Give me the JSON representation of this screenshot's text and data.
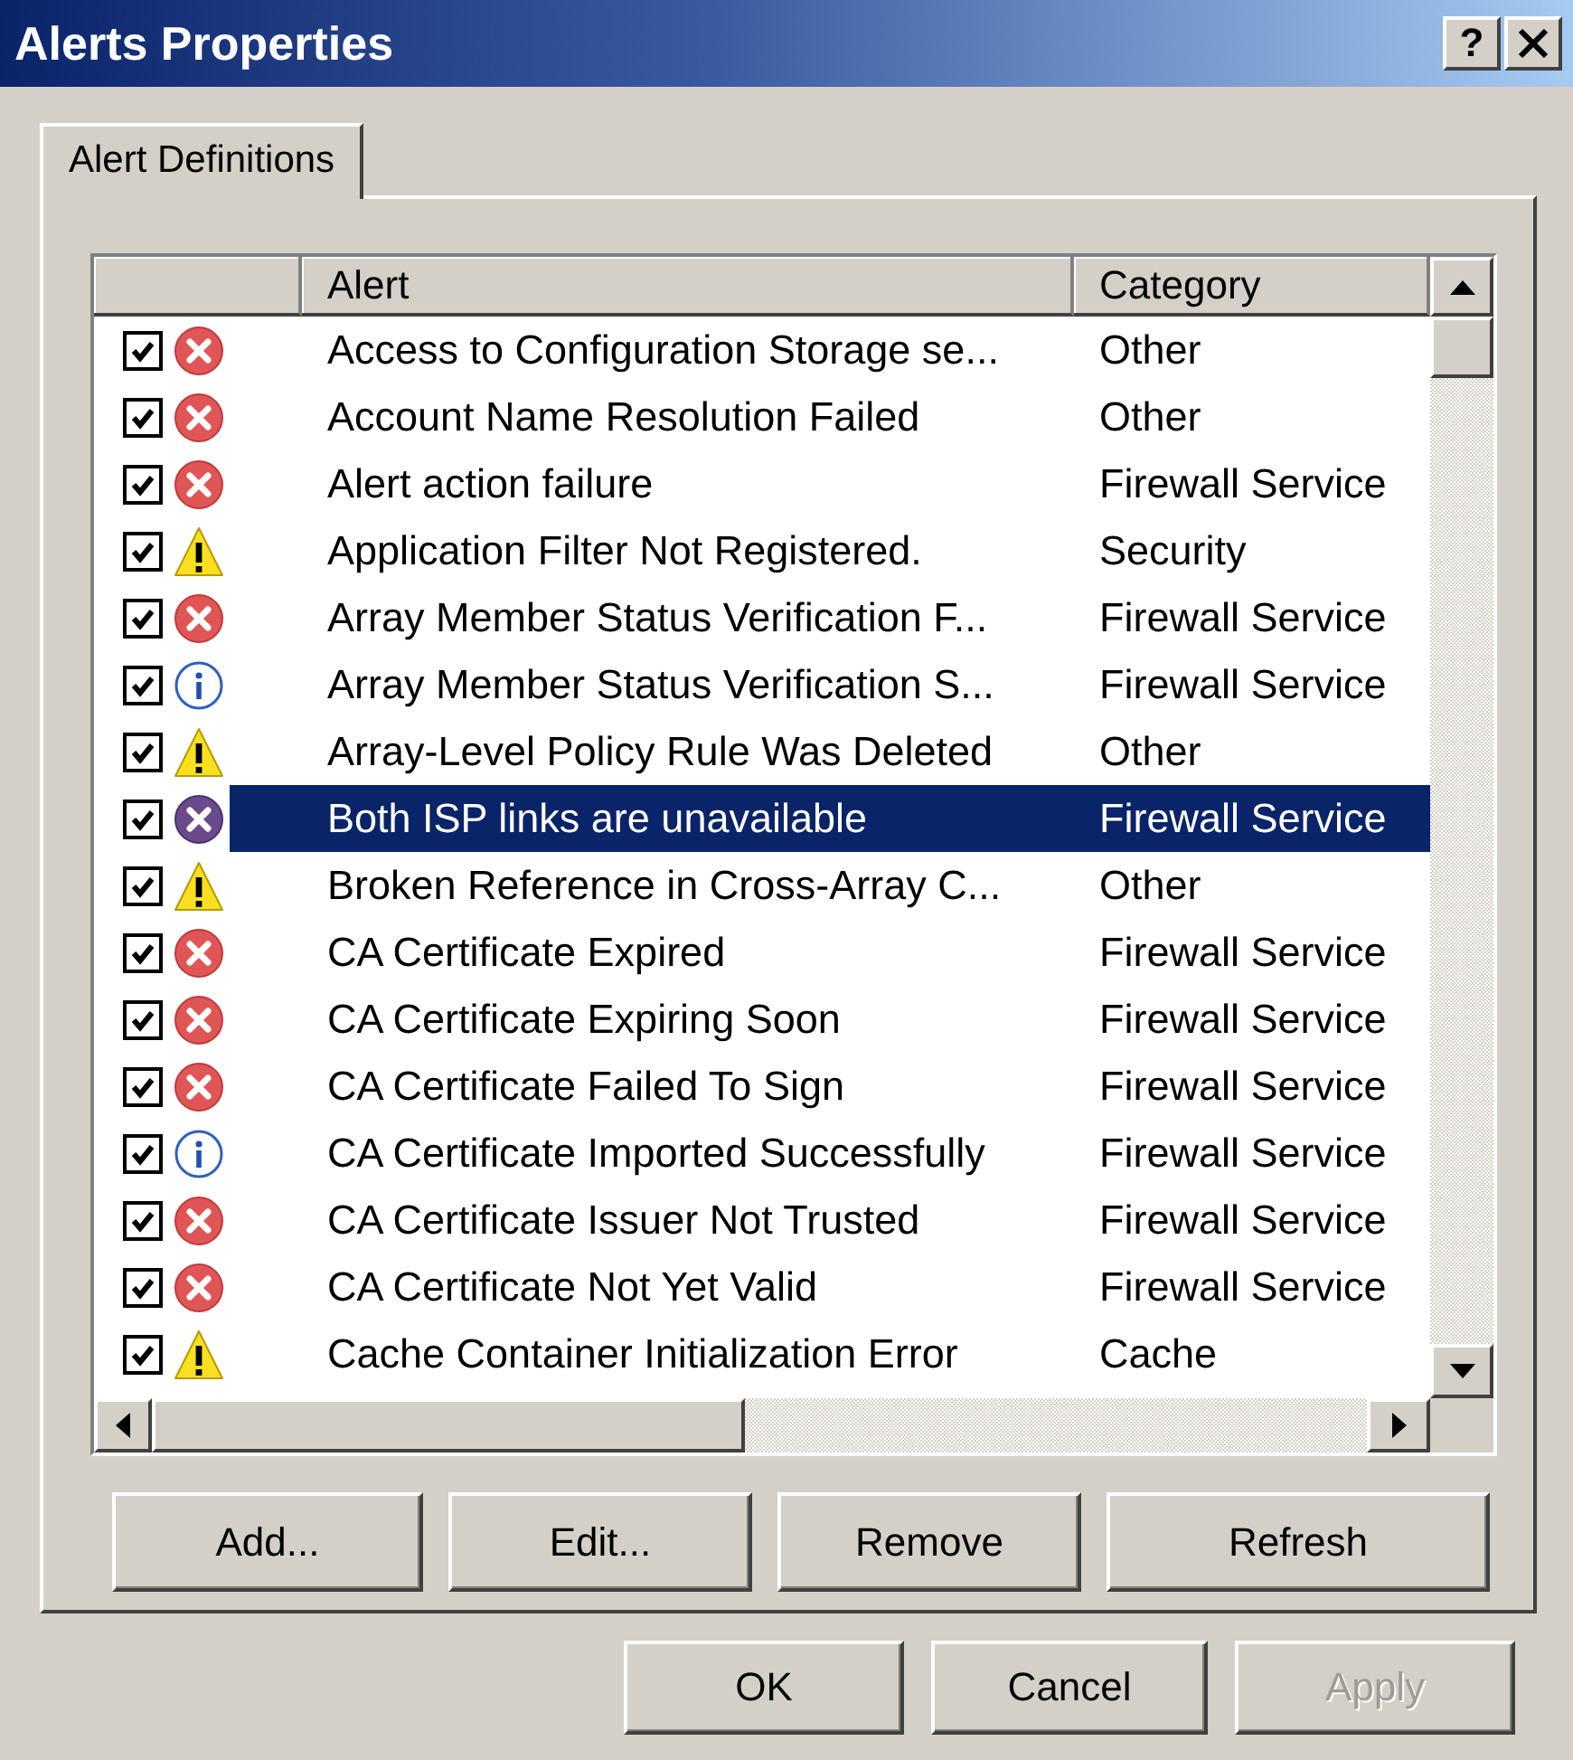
{
  "window": {
    "title": "Alerts Properties",
    "help_button": "?"
  },
  "tabs": [
    {
      "label": "Alert Definitions",
      "selected": true
    }
  ],
  "alert_list": {
    "columns": [
      "Alert",
      "Category"
    ],
    "rows": [
      {
        "checked": true,
        "kind": "error",
        "alert": "Access to Configuration Storage se...",
        "category": "Other",
        "selected": false
      },
      {
        "checked": true,
        "kind": "error",
        "alert": "Account Name Resolution Failed",
        "category": "Other",
        "selected": false
      },
      {
        "checked": true,
        "kind": "error",
        "alert": "Alert action failure",
        "category": "Firewall Service",
        "selected": false
      },
      {
        "checked": true,
        "kind": "warning",
        "alert": "Application Filter Not Registered.",
        "category": "Security",
        "selected": false
      },
      {
        "checked": true,
        "kind": "error",
        "alert": "Array Member Status Verification F...",
        "category": "Firewall Service",
        "selected": false
      },
      {
        "checked": true,
        "kind": "info",
        "alert": "Array Member Status Verification S...",
        "category": "Firewall Service",
        "selected": false
      },
      {
        "checked": true,
        "kind": "warning",
        "alert": "Array-Level Policy Rule Was Deleted",
        "category": "Other",
        "selected": false
      },
      {
        "checked": true,
        "kind": "error",
        "alert": "Both ISP links are unavailable",
        "category": "Firewall Service",
        "selected": true
      },
      {
        "checked": true,
        "kind": "warning",
        "alert": "Broken Reference in Cross-Array C...",
        "category": "Other",
        "selected": false
      },
      {
        "checked": true,
        "kind": "error",
        "alert": "CA Certificate Expired",
        "category": "Firewall Service",
        "selected": false
      },
      {
        "checked": true,
        "kind": "error",
        "alert": "CA Certificate Expiring Soon",
        "category": "Firewall Service",
        "selected": false
      },
      {
        "checked": true,
        "kind": "error",
        "alert": "CA Certificate Failed To Sign",
        "category": "Firewall Service",
        "selected": false
      },
      {
        "checked": true,
        "kind": "info",
        "alert": "CA Certificate Imported Successfully",
        "category": "Firewall Service",
        "selected": false
      },
      {
        "checked": true,
        "kind": "error",
        "alert": "CA Certificate Issuer Not Trusted",
        "category": "Firewall Service",
        "selected": false
      },
      {
        "checked": true,
        "kind": "error",
        "alert": "CA Certificate Not Yet Valid",
        "category": "Firewall Service",
        "selected": false
      },
      {
        "checked": true,
        "kind": "warning",
        "alert": "Cache Container Initialization Error",
        "category": "Cache",
        "selected": false
      }
    ]
  },
  "list_buttons": [
    {
      "label": "Add..."
    },
    {
      "label": "Edit..."
    },
    {
      "label": "Remove"
    },
    {
      "label": "Refresh"
    }
  ],
  "dialog_buttons": [
    {
      "label": "OK",
      "disabled": false
    },
    {
      "label": "Cancel",
      "disabled": false
    },
    {
      "label": "Apply",
      "disabled": true
    }
  ]
}
